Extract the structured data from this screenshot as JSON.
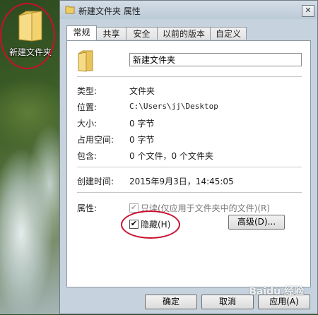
{
  "desktop": {
    "icon_label": "新建文件夹"
  },
  "dialog": {
    "title": "新建文件夹 属性",
    "close_glyph": "✕",
    "tabs": [
      "常规",
      "共享",
      "安全",
      "以前的版本",
      "自定义"
    ],
    "name_value": "新建文件夹",
    "fields": [
      {
        "label": "类型:",
        "value": "文件夹"
      },
      {
        "label": "位置:",
        "value": "C:\\Users\\jj\\Desktop"
      },
      {
        "label": "大小:",
        "value": "0 字节"
      },
      {
        "label": "占用空间:",
        "value": "0 字节"
      },
      {
        "label": "包含:",
        "value": "0 个文件，0 个文件夹"
      }
    ],
    "created": {
      "label": "创建时间:",
      "value": "2015年9月3日，14:45:05"
    },
    "attributes": {
      "label": "属性:",
      "readonly_label": "只读(仅应用于文件夹中的文件)(R)",
      "readonly_checked": true,
      "hidden_label": "隐藏(H)",
      "hidden_checked": true,
      "advanced_button": "高级(D)..."
    },
    "buttons": {
      "ok": "确定",
      "cancel": "取消",
      "apply": "应用(A)"
    },
    "checkmark": "✔"
  },
  "watermark": "Baidu 经验",
  "colors": {
    "annotation_red": "#c8102e",
    "folder_yellow": "#f0cf62"
  }
}
